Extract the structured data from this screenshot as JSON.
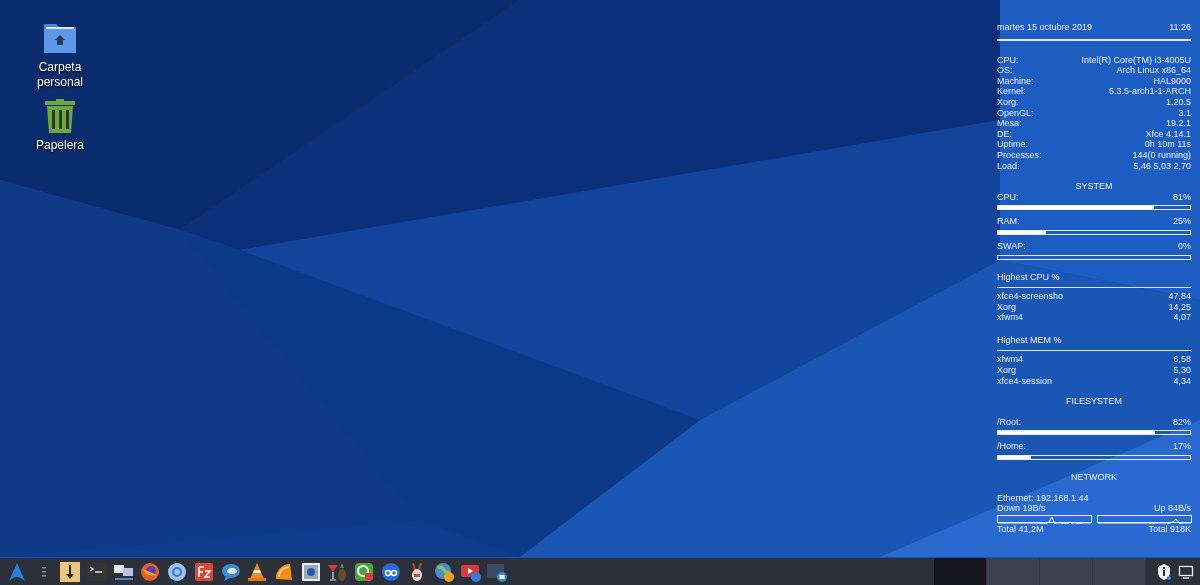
{
  "desktop_icons": [
    {
      "label": "Carpeta personal",
      "kind": "folder"
    },
    {
      "label": "Papelera",
      "kind": "trash"
    }
  ],
  "conky": {
    "date": "martes 15 octubre 2019",
    "time": "11:26",
    "info": [
      {
        "label": "CPU:",
        "value": "Intel(R) Core(TM) i3-4005U"
      },
      {
        "label": "OS:",
        "value": "Arch Linux x86_64"
      },
      {
        "label": "Machine:",
        "value": "HAL9000"
      },
      {
        "label": "Kernel:",
        "value": "5.3.5-arch1-1-ARCH"
      },
      {
        "label": "Xorg:",
        "value": "1.20.5"
      },
      {
        "label": "OpenGL:",
        "value": "3.1"
      },
      {
        "label": "Mesa:",
        "value": "19.2.1"
      },
      {
        "label": "DE:",
        "value": "Xfce 4.14.1"
      },
      {
        "label": "Uptime:",
        "value": "0h 10m 11s"
      },
      {
        "label": "Processes:",
        "value": "144(0 running)"
      },
      {
        "label": "Load:",
        "value": "5,46 5,03 2,70"
      }
    ],
    "system": {
      "title": "SYSTEM",
      "meters": [
        {
          "label": "CPU:",
          "reading": "81%",
          "level": 0.81
        },
        {
          "label": "RAM:",
          "reading": "25%",
          "level": 0.25
        },
        {
          "label": "SWAP:",
          "reading": "0%",
          "level": 0
        }
      ]
    },
    "highest_cpu": {
      "title": "Highest CPU %",
      "processes": [
        {
          "name": "xfce4-screensho",
          "value": "47,84"
        },
        {
          "name": "Xorg",
          "value": "14,25"
        },
        {
          "name": "xfwm4",
          "value": "4,07"
        }
      ]
    },
    "highest_mem": {
      "title": "Highest MEM %",
      "processes": [
        {
          "name": "xfwm4",
          "value": "6,58"
        },
        {
          "name": "Xorg",
          "value": "5,30"
        },
        {
          "name": "xfce4-session",
          "value": "4,34"
        }
      ]
    },
    "filesystem": {
      "title": "FILESYSTEM",
      "meters": [
        {
          "label": "/Root:",
          "reading": "82%",
          "level": 0.82
        },
        {
          "label": "/Home:",
          "reading": "17%",
          "level": 0.17
        }
      ]
    },
    "network": {
      "title": "NETWORK",
      "ethernet": "Ethernet: 192.168.1.44",
      "down": "Down 19B/s",
      "up": "Up 84B/s",
      "total_down": "Total 41,2M",
      "total_up": "Total 918K"
    }
  },
  "taskbar": {
    "workspaces": [
      {
        "selected": true
      },
      {
        "selected": false
      },
      {
        "selected": false
      },
      {
        "selected": false
      }
    ]
  }
}
